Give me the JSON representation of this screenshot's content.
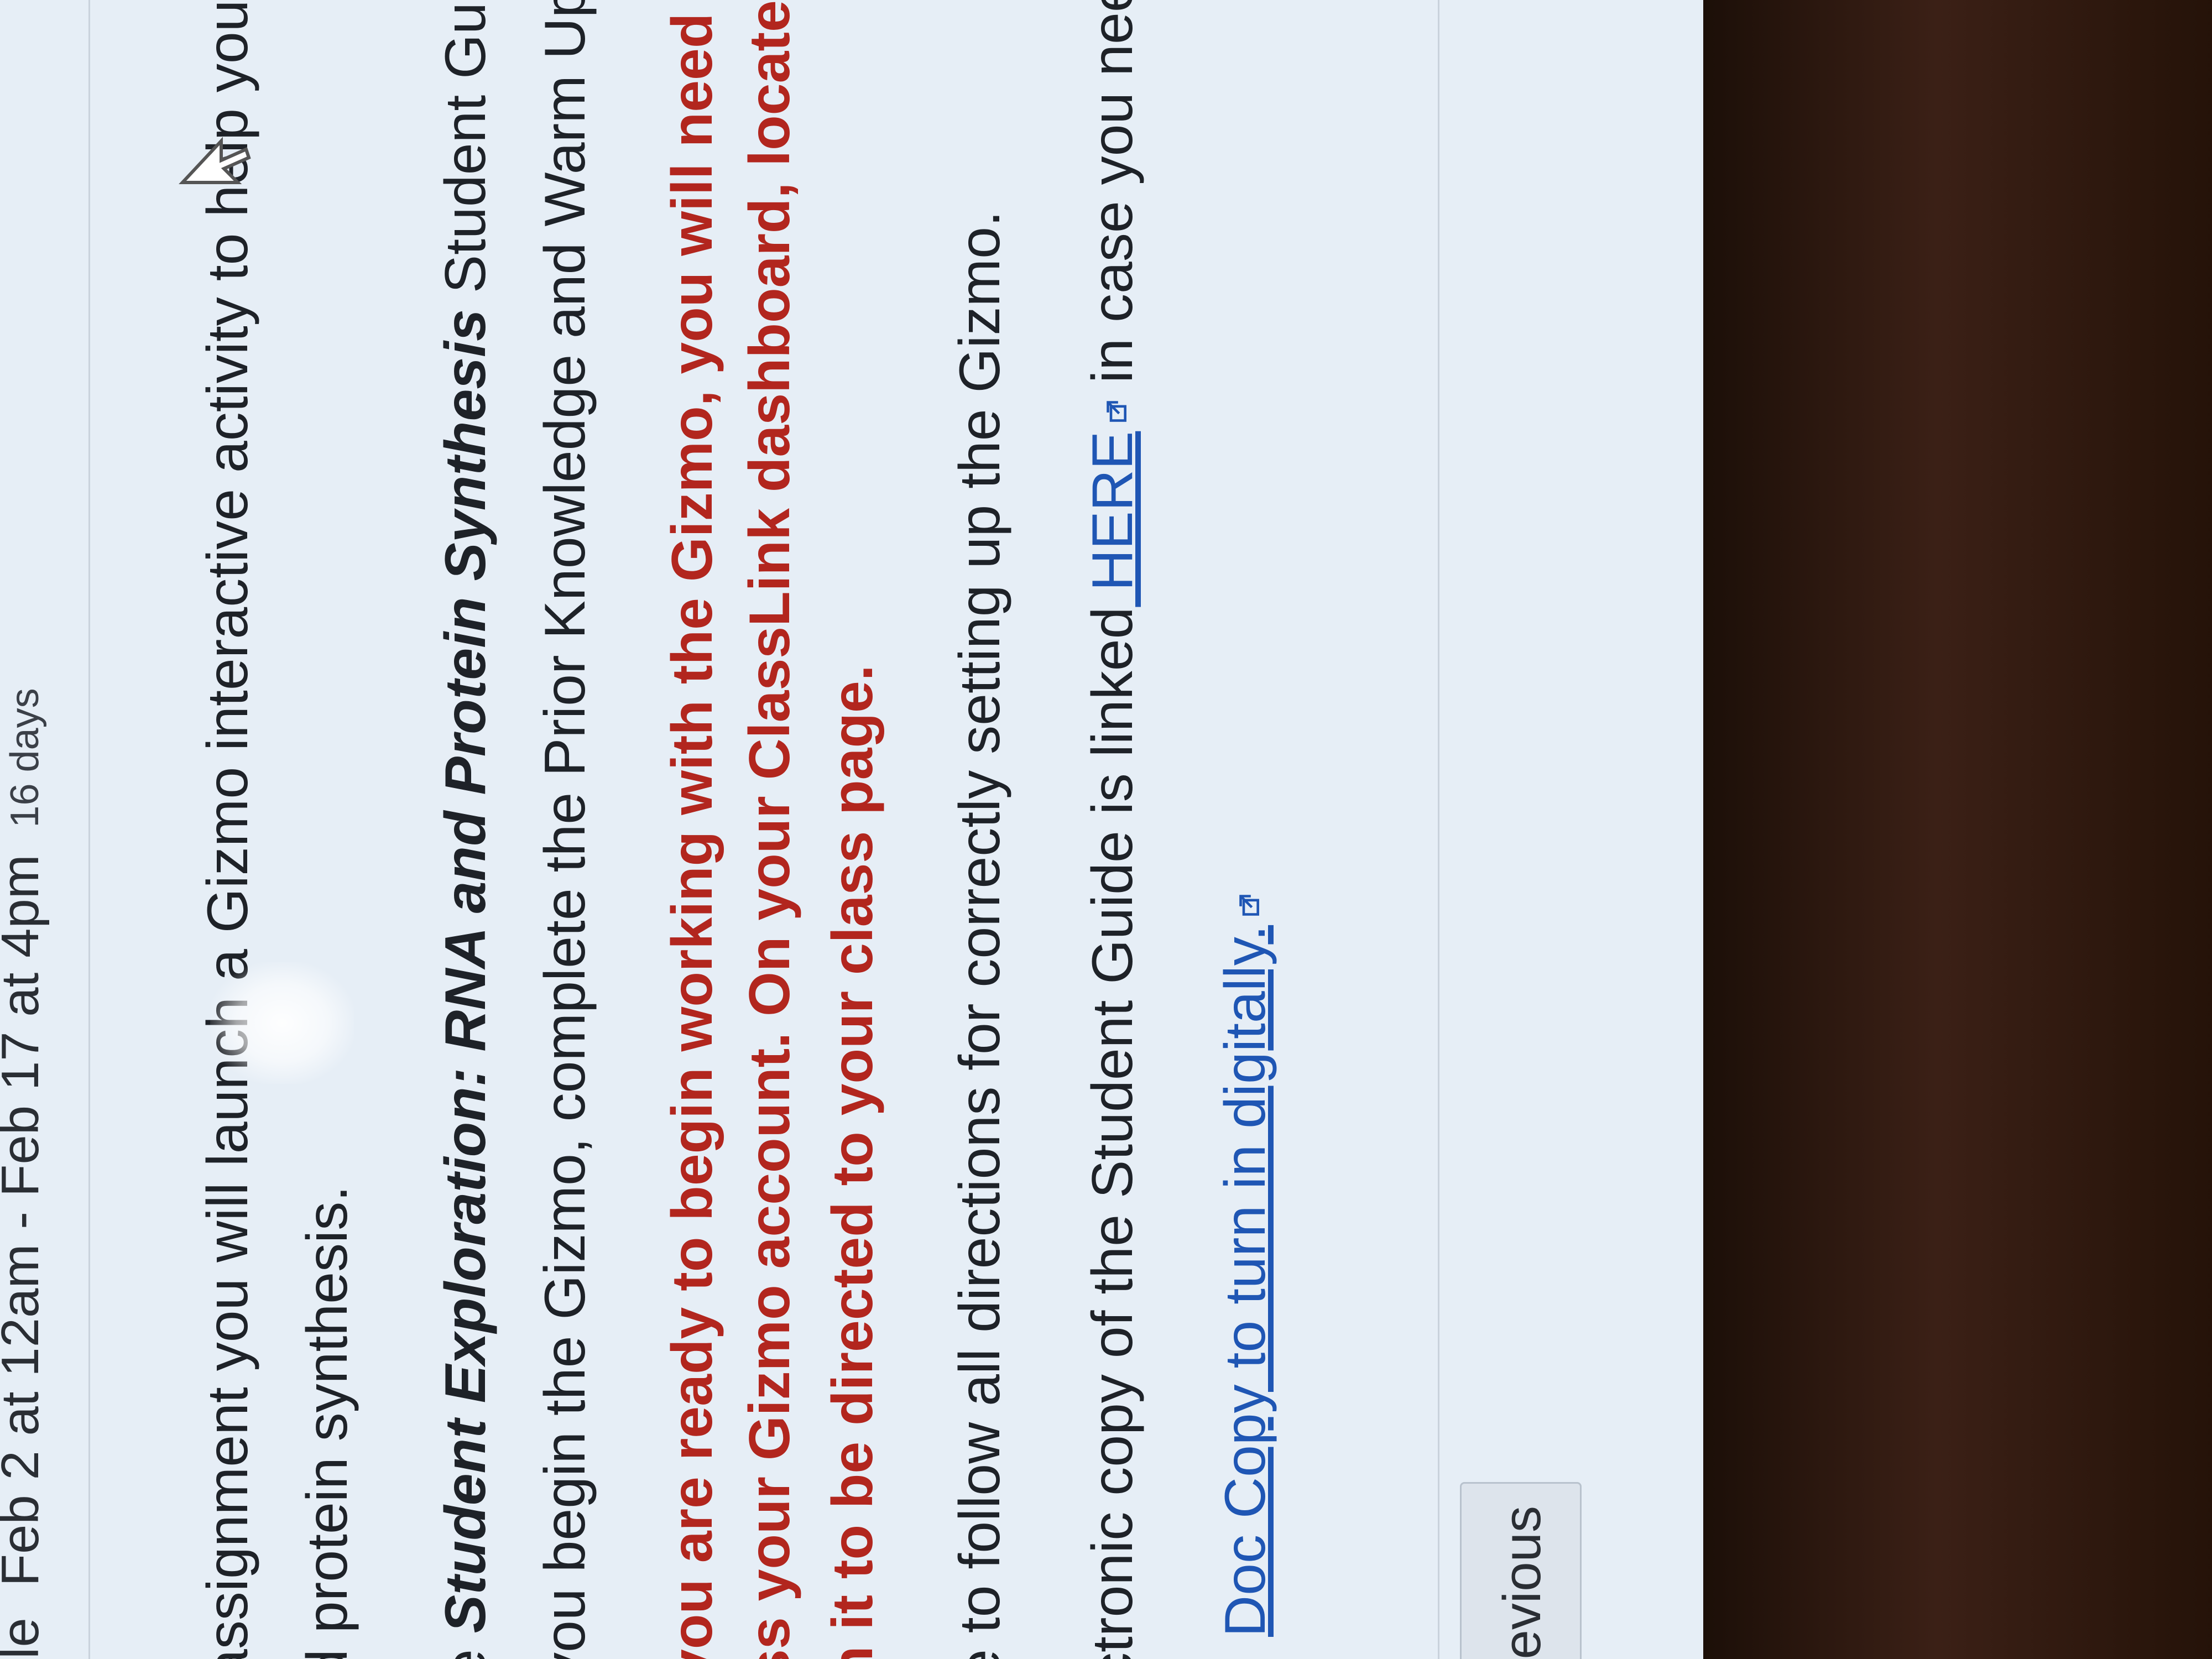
{
  "due": {
    "prefix": "le",
    "range": "Feb 2 at 12am - Feb 17 at 4pm",
    "duration": "16 days"
  },
  "body": {
    "p1_line1": "assignment you will launch a Gizmo interactive activity to help you le",
    "p1_line2": "d protein synthesis.",
    "p2_line1_a": "e ",
    "p2_line1_b": "Student Exploration: RNA and Protein Synthesis",
    "p2_line1_c": " Student Guide in you",
    "p2_line2": "you begin the Gizmo, complete the Prior Knowledge and Warm Up s",
    "p3_line1": "you are ready to begin working with the Gizmo, you will need to go t",
    "p3_line2": "ss your Gizmo account.  On your ClassLink dashboard, locate the Giz",
    "p3_line3": "n it to be directed to your class page.",
    "p4_line1": "e to follow all directions for correctly setting up the Gizmo.",
    "p5_line1_a": "ctronic copy of the Student Guide is linked",
    "p5_line1_link": " HERE",
    "p5_line1_b": "  in case you need i",
    "p6_link": "Doc Copy to turn in digitally."
  },
  "nav": {
    "previous_label": "evious"
  },
  "icons": {
    "external": "external-link-icon",
    "cursor": "arrow-cursor-icon"
  },
  "colors": {
    "page_bg": "#e6eef6",
    "text": "#1e2228",
    "emphasis_red": "#b2261e",
    "link_blue": "#1f56b4"
  }
}
